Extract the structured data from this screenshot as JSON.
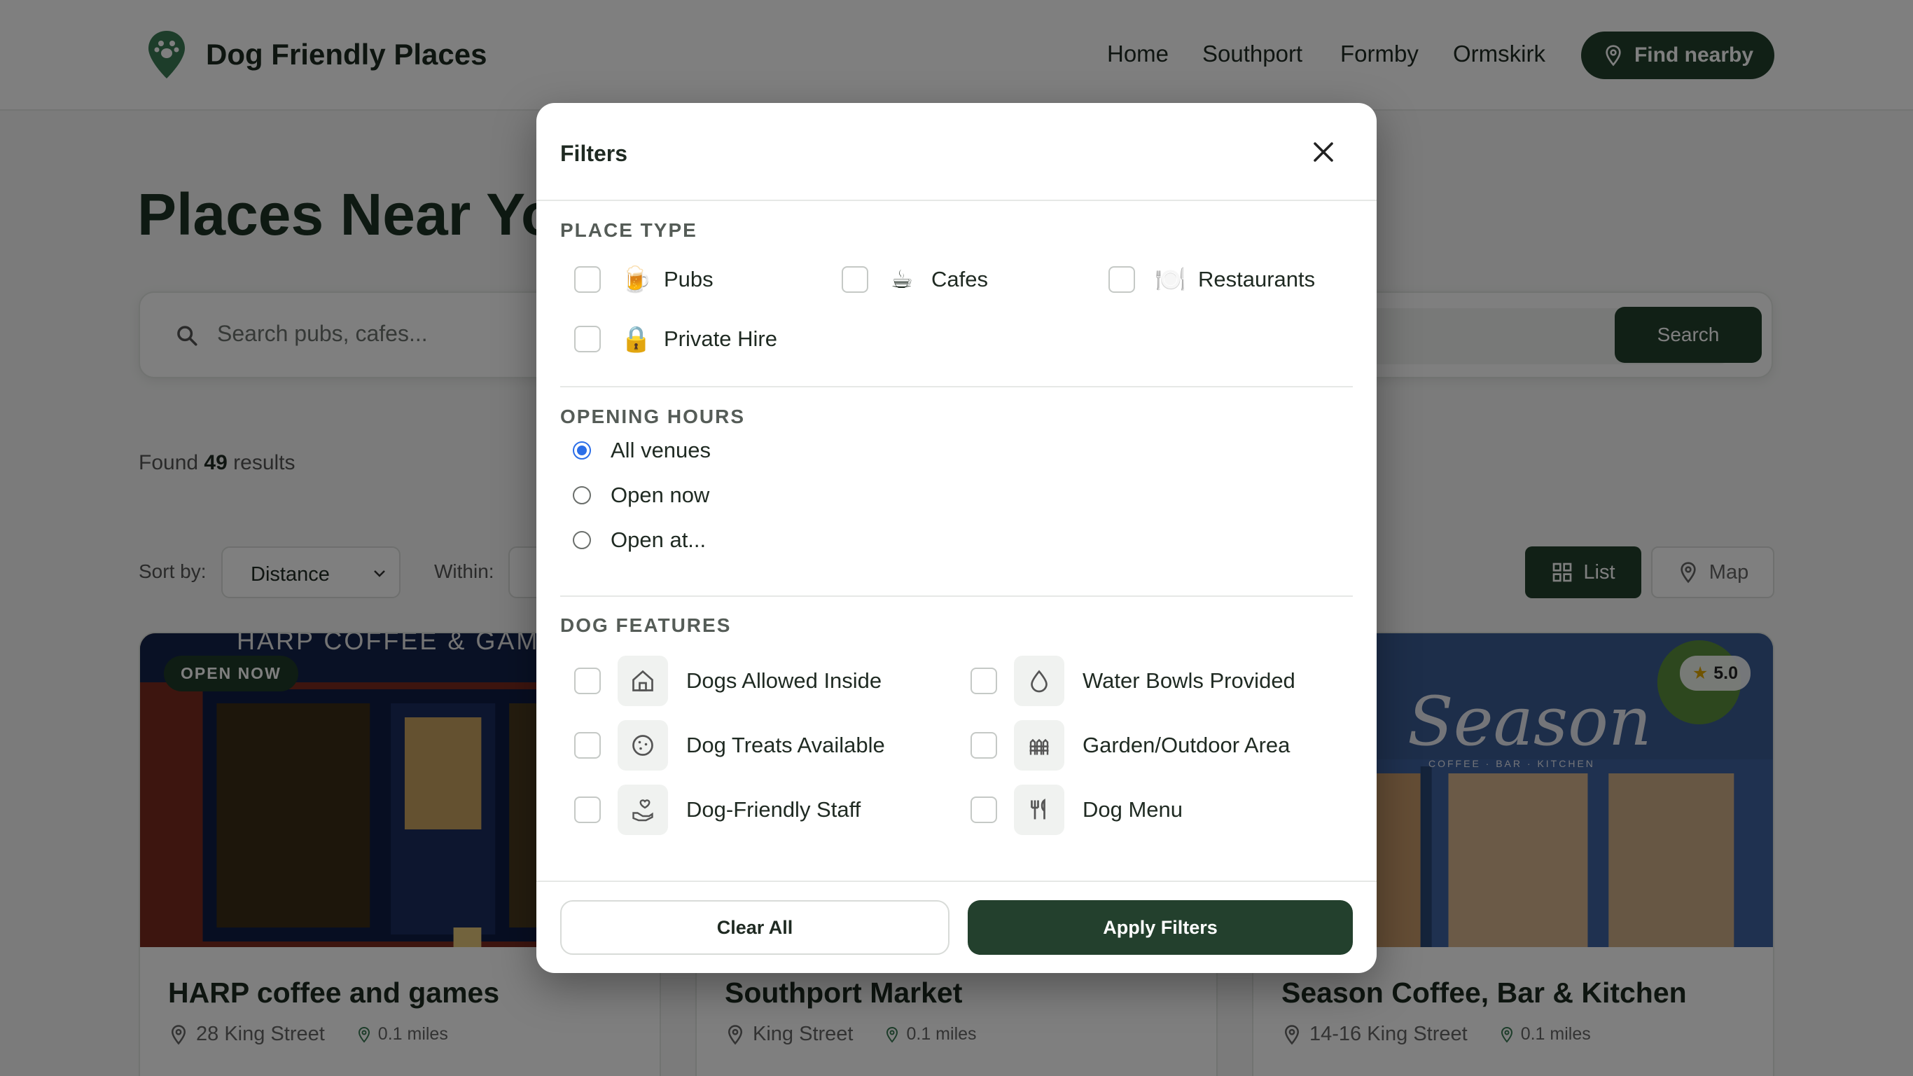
{
  "header": {
    "logo_text": "Dog Friendly Places",
    "nav": [
      "Home",
      "Southport",
      "Formby",
      "Ormskirk"
    ],
    "find_nearby": "Find nearby"
  },
  "main": {
    "title": "Places Near You",
    "search_placeholder": "Search pubs, cafes...",
    "search_button": "Search",
    "found_prefix": "Found",
    "found_count": "49",
    "found_suffix": "results",
    "sort_label": "Sort by:",
    "sort_value": "Distance",
    "within_label": "Within:",
    "view_list": "List",
    "view_map": "Map"
  },
  "cards": [
    {
      "title": "HARP coffee and games",
      "address": "28 King Street",
      "distance": "0.1 miles",
      "badge": "OPEN NOW",
      "sign": "HARP COFFEE & GAMES"
    },
    {
      "title": "Southport Market",
      "address": "King Street",
      "distance": "0.1 miles"
    },
    {
      "title": "Season Coffee, Bar & Kitchen",
      "address": "14-16 King Street",
      "distance": "0.1 miles",
      "rating": "5.0",
      "sign": "Season",
      "sign_sub": "COFFEE · BAR · KITCHEN"
    }
  ],
  "modal": {
    "title": "Filters",
    "place_type": {
      "label": "PLACE TYPE",
      "options": [
        {
          "label": "Pubs",
          "emoji": "🍺"
        },
        {
          "label": "Cafes",
          "emoji": "☕"
        },
        {
          "label": "Restaurants",
          "emoji": "🍽️"
        },
        {
          "label": "Private Hire",
          "emoji": "🔒"
        }
      ]
    },
    "opening_hours": {
      "label": "OPENING HOURS",
      "options": [
        "All venues",
        "Open now",
        "Open at..."
      ],
      "selected": "All venues"
    },
    "dog_features": {
      "label": "DOG FEATURES",
      "options": [
        {
          "label": "Dogs Allowed Inside",
          "icon": "house-icon"
        },
        {
          "label": "Water Bowls Provided",
          "icon": "water-drop-icon"
        },
        {
          "label": "Dog Treats Available",
          "icon": "cookie-icon"
        },
        {
          "label": "Garden/Outdoor Area",
          "icon": "fence-icon"
        },
        {
          "label": "Dog-Friendly Staff",
          "icon": "hand-heart-icon"
        },
        {
          "label": "Dog Menu",
          "icon": "utensils-icon"
        }
      ]
    },
    "clear_all": "Clear All",
    "apply": "Apply Filters"
  },
  "colors": {
    "brand": "#23402d",
    "radio_selected": "#2b6ee8"
  }
}
